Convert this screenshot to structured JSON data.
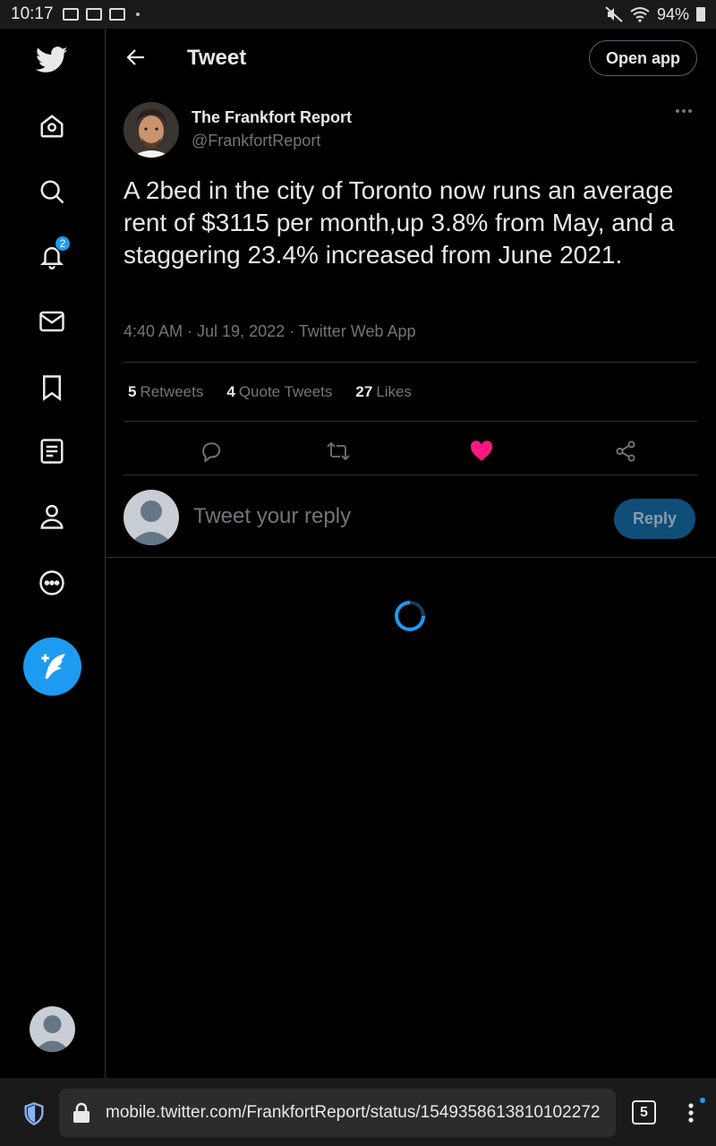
{
  "status_bar": {
    "time": "10:17",
    "battery": "94%"
  },
  "header": {
    "title": "Tweet",
    "open_app_label": "Open app"
  },
  "sidebar": {
    "notifications_badge": "2"
  },
  "tweet": {
    "author_name": "The Frankfort Report",
    "author_handle": "@FrankfortReport",
    "text": "A 2bed in the city of Toronto now runs an average rent of $3115 per month,up 3.8% from May, and a staggering 23.4% increased from June 2021.",
    "meta": "4:40 AM · Jul 19, 2022 · Twitter Web App",
    "stats": {
      "retweets_count": "5",
      "retweets_label": "Retweets",
      "quotes_count": "4",
      "quotes_label": "Quote Tweets",
      "likes_count": "27",
      "likes_label": "Likes"
    }
  },
  "reply": {
    "placeholder": "Tweet your reply",
    "button_label": "Reply"
  },
  "browser": {
    "url": "mobile.twitter.com/FrankfortReport/status/1549358613810102272",
    "tab_count": "5"
  },
  "colors": {
    "accent": "#1d9bf0",
    "like": "#f91880",
    "background": "#000000",
    "border": "#2f3336",
    "muted_text": "#71767b"
  }
}
